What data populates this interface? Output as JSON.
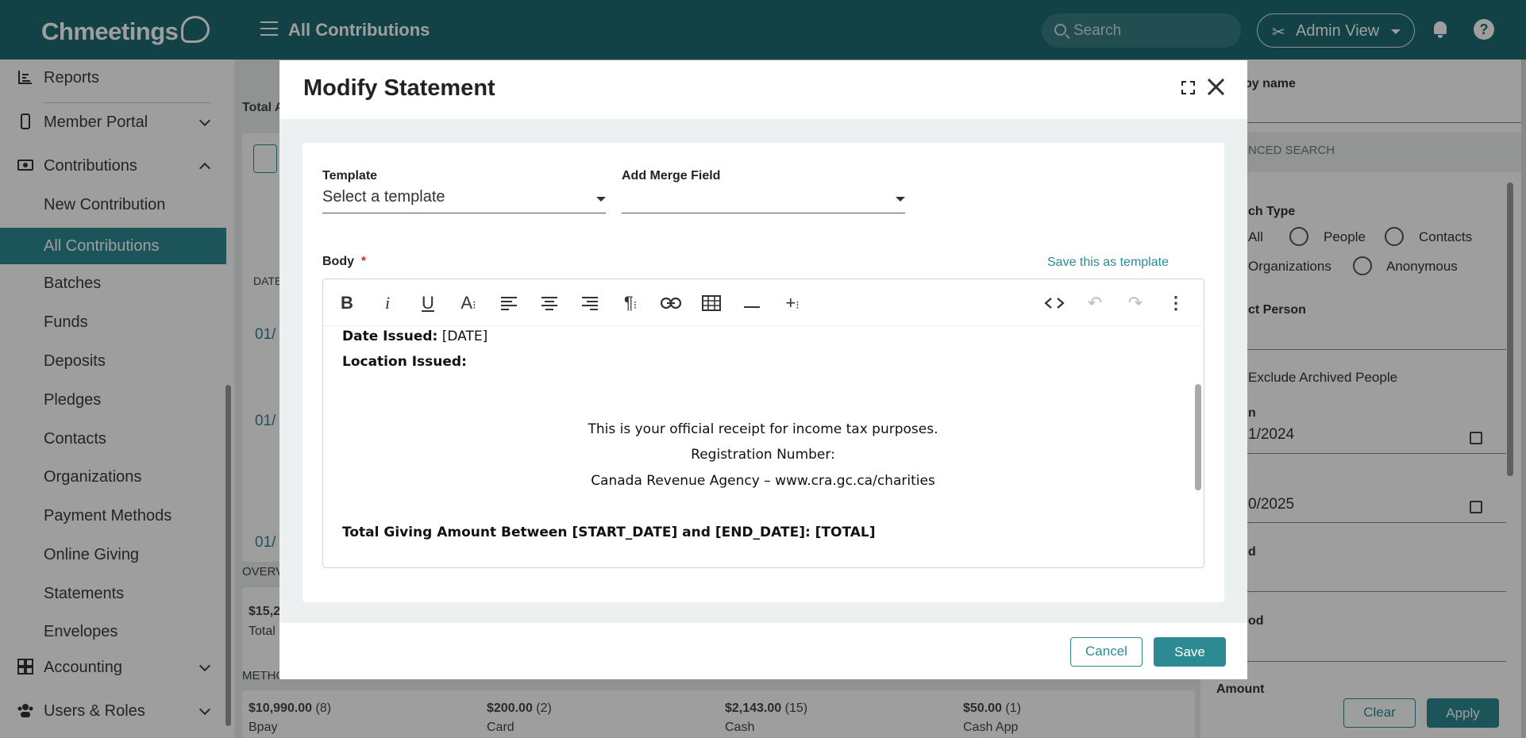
{
  "header": {
    "logo_text": "Chmeetings",
    "page_title": "All Contributions",
    "search_placeholder": "Search",
    "admin_view_label": "Admin View",
    "help_label": "?"
  },
  "sidebar": {
    "reports": "Reports",
    "member_portal": "Member Portal",
    "contributions": "Contributions",
    "sub_items": [
      "New Contribution",
      "All Contributions",
      "Batches",
      "Funds",
      "Deposits",
      "Pledges",
      "Contacts",
      "Organizations",
      "Payment Methods",
      "Online Giving",
      "Statements",
      "Envelopes"
    ],
    "accounting": "Accounting",
    "users_roles": "Users & Roles"
  },
  "background": {
    "total_label_partial": "Total A",
    "date_header_partial": "DATE",
    "dates_partial": [
      "01/",
      "01/",
      "01/"
    ],
    "overview_label_partial": "OVERV",
    "overview_amount_partial": "$15,2",
    "overview_total_partial": "Total",
    "methods_label_partial": "METHOD",
    "methods": [
      {
        "amount": "$10,990.00",
        "count": "(8)",
        "name_partial": "Bpay"
      },
      {
        "amount": "$200.00",
        "count": "(2)",
        "name_partial": "Card"
      },
      {
        "amount": "$2,143.00",
        "count": "(15)",
        "name_partial": "Cash"
      },
      {
        "amount": "$50.00",
        "count": "(1)",
        "name_partial": "Cash App"
      }
    ]
  },
  "right_panel": {
    "by_name_partial": "by name",
    "advanced_search_partial": "NCED SEARCH",
    "search_type_partial": "ch Type",
    "types": [
      "All",
      "People",
      "Contacts",
      "Organizations",
      "Anonymous"
    ],
    "select_person_partial": "ct Person",
    "exclude_archived": "Exclude Archived People",
    "from_label_partial": "n",
    "from_date_partial": "1/2024",
    "to_date_partial": "0/2025",
    "fund_label_partial": "d",
    "period_label_partial": "od",
    "amount_label": "Amount",
    "clear_label": "Clear",
    "apply_label": "Apply"
  },
  "modal": {
    "title": "Modify Statement",
    "template_label": "Template",
    "template_value": "Select a template",
    "merge_field_label": "Add Merge Field",
    "merge_field_value": "",
    "body_label": "Body",
    "required_mark": "*",
    "save_as_template": "Save this as template",
    "toolbar_icons": [
      "bold-icon",
      "italic-icon",
      "underline-icon",
      "font-size-icon",
      "align-left-icon",
      "align-center-icon",
      "align-right-icon",
      "paragraph-icon",
      "link-icon",
      "table-icon",
      "horizontal-rule-icon",
      "insert-icon",
      "code-view-icon",
      "undo-icon",
      "redo-icon",
      "more-icon"
    ],
    "content": {
      "date_issued_label": "Date Issued:",
      "date_issued_value": "[DATE]",
      "location_issued_label": "Location Issued:",
      "receipt_line": "This is your official receipt for income tax purposes.",
      "registration_line": "Registration Number:",
      "cra_line": "Canada Revenue Agency – www.cra.gc.ca/charities",
      "total_line": "Total Giving Amount Between [START_DATE] and [END_DATE]: [TOTAL]"
    },
    "cancel_label": "Cancel",
    "save_label": "Save"
  },
  "colors": {
    "topbar": "#1d6b72",
    "accent": "#2c8a92",
    "required": "#d32f2f"
  }
}
